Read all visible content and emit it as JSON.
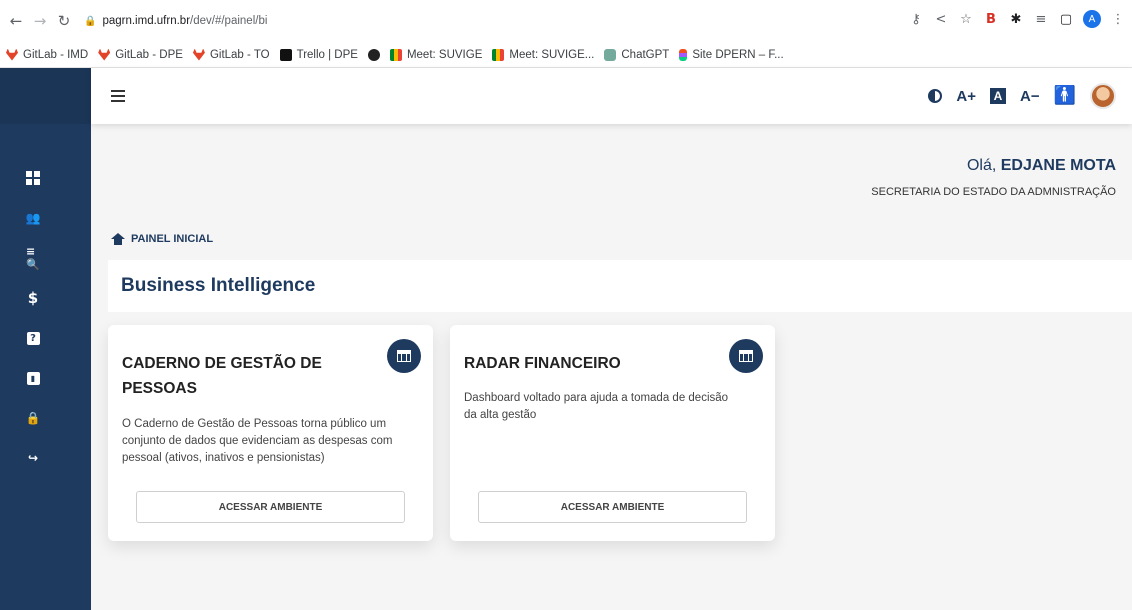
{
  "browser": {
    "url_host": "pagrn.imd.ufrn.br",
    "url_path": "/dev/#/painel/bi",
    "profile_initial": "A"
  },
  "bookmarks": [
    {
      "label": "GitLab - IMD",
      "icon": "gitlab-icon"
    },
    {
      "label": "GitLab - DPE",
      "icon": "gitlab-icon"
    },
    {
      "label": "GitLab - TO",
      "icon": "gitlab-icon"
    },
    {
      "label": "Trello | DPE",
      "icon": "trello-icon"
    },
    {
      "label": "",
      "icon": "globe-icon"
    },
    {
      "label": "Meet: SUVIGE",
      "icon": "meet-icon"
    },
    {
      "label": "Meet: SUVIGE...",
      "icon": "meet-icon"
    },
    {
      "label": "ChatGPT",
      "icon": "chatgpt-icon"
    },
    {
      "label": "Site DPERN – F...",
      "icon": "figma-icon"
    }
  ],
  "topbar": {
    "font_increase": "A+",
    "font_box": "A",
    "font_decrease": "A−"
  },
  "greeting": {
    "prefix": "Olá, ",
    "name": "EDJANE MOTA",
    "organization": "SECRETARIA DO ESTADO DA ADMNISTRAÇÃO"
  },
  "breadcrumb": {
    "label": "PAINEL INICIAL"
  },
  "section": {
    "title": "Business Intelligence"
  },
  "cards": [
    {
      "title": "CADERNO DE GESTÃO DE PESSOAS",
      "description": "O Caderno de Gestão de Pessoas torna público um conjunto de dados que evidenciam as despesas com pessoal (ativos, inativos e pensionistas)",
      "button": "ACESSAR AMBIENTE"
    },
    {
      "title": "RADAR FINANCEIRO",
      "description": "Dashboard voltado para ajuda a tomada de decisão da alta gestão",
      "button": "ACESSAR AMBIENTE"
    }
  ],
  "colors": {
    "sidebar": "#1e3a5f",
    "accent": "#1e3a5f",
    "background": "#f5f5f5"
  }
}
